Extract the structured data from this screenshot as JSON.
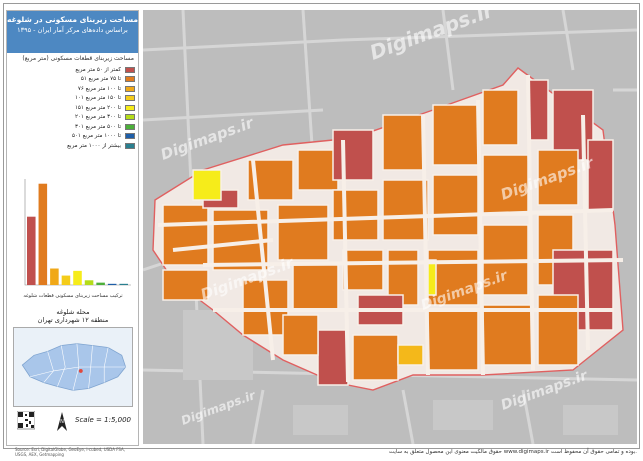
{
  "panel": {
    "title_line1": "مساحت زیربنای مسکونی در شلوغه",
    "title_line2": "براساس داده‌های مرکز آمار ایران - ۱۳۹۵",
    "legend_heading": "مساحت زیربنای قطعات مسکونی (متر مربع)",
    "legend": [
      {
        "label": "کمتر از ۵۰ متر مربع",
        "color": "#c0504d"
      },
      {
        "label": "۵۱ تا ۷۵ متر مربع",
        "color": "#e07b1f"
      },
      {
        "label": "۷۶ تا ۱۰۰ متر مربع",
        "color": "#f0a818"
      },
      {
        "label": "۱۰۱ تا ۱۵۰ متر مربع",
        "color": "#f4cc1a"
      },
      {
        "label": "۱۵۱ تا ۲۰۰ متر مربع",
        "color": "#f6ec1a"
      },
      {
        "label": "۲۰۱ تا ۳۰۰ متر مربع",
        "color": "#b4dc1a"
      },
      {
        "label": "۳۰۱ تا ۵۰۰ متر مربع",
        "color": "#4caf3a"
      },
      {
        "label": "۵۰۱ تا ۱۰۰۰ متر مربع",
        "color": "#1f5fa8"
      },
      {
        "label": "بیشتر از ۱۰۰۰ متر مربع",
        "color": "#2a7f8f"
      }
    ],
    "chart_caption": "ترکیب مساحت زیربنای مسکونی قطعات شلوغه",
    "neighborhood_name": "محله شلوغه",
    "district_name": "منطقه ۱۲ شهرداری تهران",
    "scale_text": "Scale = 1:5,000",
    "credits": "Source: Esri, DigitalGlobe, GeoEye, i-cubed, USDA FSA, USGS, AEX, Getmapping"
  },
  "chart_data": {
    "type": "bar",
    "categories": [
      "<50",
      "51-75",
      "76-100",
      "101-150",
      "151-200",
      "201-300",
      "301-500",
      "501-1000",
      ">1000"
    ],
    "values": [
      58,
      86,
      14,
      8,
      12,
      4,
      2,
      1,
      1
    ],
    "colors": [
      "#c0504d",
      "#e07b1f",
      "#f0a818",
      "#f4cc1a",
      "#f6ec1a",
      "#b4dc1a",
      "#4caf3a",
      "#1f5fa8",
      "#2a7f8f"
    ],
    "ylim": [
      0,
      90
    ]
  },
  "map": {
    "watermark": "Digimaps.ir",
    "fill_main": "#e07b1f",
    "fill_small": "#c0504d",
    "fill_yellow": "#f6ec1a",
    "fill_gold": "#f4b81a",
    "boundary": "#e06060",
    "background": "#bdbdbd"
  },
  "footer": "حقوق مالکیت معنوی این محصول متعلق به سایت www.digimaps.ir بوده و تمامی حقوق آن محفوظ است."
}
